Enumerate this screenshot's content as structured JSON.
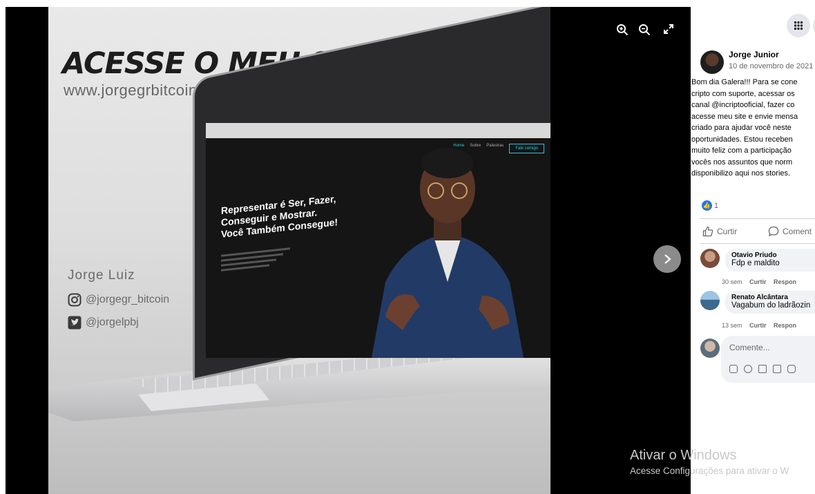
{
  "photo": {
    "title": "ACESSE O MEU SITE!",
    "url": "www.jorgegrbitcoin.com.br",
    "name": "Jorge Luiz",
    "instagram": "@jorgegr_bitcoin",
    "twitter": "@jorgelpbj",
    "screen": {
      "nav": [
        "Home",
        "Sobre",
        "Palestras"
      ],
      "cta": "Fale comigo",
      "headline": [
        "Representar é Ser, Fazer,",
        "Conseguir e Mostrar.",
        "Você Também Consegue!"
      ]
    }
  },
  "viewer": {
    "zoom_in_icon": "zoom-in-icon",
    "zoom_out_icon": "zoom-out-icon",
    "fullscreen_icon": "fullscreen-icon",
    "next_icon": "chevron-right-icon"
  },
  "post": {
    "author": "Jorge Junior",
    "date": "10 de novembro de 2021",
    "text_lines": [
      "Bom dia Galera!!! Para se cone",
      "cripto com suporte, acessar os",
      "canal @incriptooficial, fazer co",
      "acesse meu site e envie mensa",
      "criado para ajudar você neste",
      "oportunidades. Estou receben",
      "muito feliz com a participação",
      "vocês nos assuntos que norm",
      "disponibilizo aqui nos stories."
    ],
    "reaction_count": "1",
    "like_label": "Curtir",
    "comment_label": "Coment"
  },
  "comments": [
    {
      "author": "Otavio Priudo",
      "text": "Fdp e maldito",
      "time": "30 sem",
      "like": "Curtir",
      "reply": "Respon"
    },
    {
      "author": "Renato Alcântara",
      "text": "Vagabum do ladrãozin",
      "time": "13 sem",
      "like": "Curtir",
      "reply": "Respon"
    }
  ],
  "composer": {
    "placeholder": "Comente..."
  },
  "watermark": {
    "line1": "Ativar o Windows",
    "line2": "Acesse Configurações para ativar o W"
  },
  "colors": {
    "accent": "#1877f2",
    "viewer_bg": "#000000",
    "cta": "#32c6d8"
  }
}
